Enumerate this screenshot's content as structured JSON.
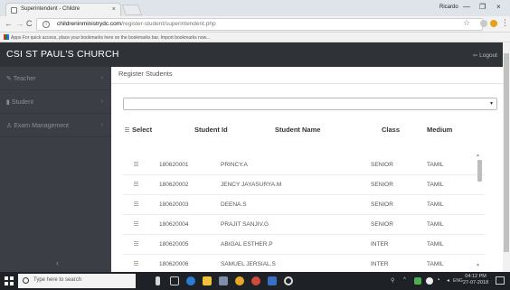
{
  "browser": {
    "tab_title": "Superintendent - Childre",
    "tab_close": "×",
    "profile_name": "Ricardo",
    "controls": {
      "minimize": "—",
      "maximize": "❐",
      "close": "×"
    },
    "nav": {
      "back": "←",
      "forward": "→",
      "reload": "C"
    },
    "url_host": "childreninministrydc.com",
    "url_path": "/register-student/superintendent.php",
    "bookmarks_text": "Apps   For quick access, place your bookmarks here on the bookmarks bar. Import bookmarks now...",
    "star": "☆",
    "menu": "⋮"
  },
  "header": {
    "brand": "CSI ST PAUL'S CHURCH",
    "logout": "⇦ Logout"
  },
  "sidebar": {
    "items": [
      {
        "icon": "✎",
        "label": "Teacher",
        "chev": "›"
      },
      {
        "icon": "▮",
        "label": "Student",
        "chev": "›"
      },
      {
        "icon": "♙",
        "label": "Exam Management",
        "chev": "›"
      }
    ],
    "collapse": "‹"
  },
  "main": {
    "panel_title": "Register Students",
    "select_caret": "▾",
    "columns": [
      "Select",
      "Student Id",
      "Student Name",
      "Class",
      "Medium"
    ],
    "rows": [
      {
        "id": "180620001",
        "name": "PRINCY.A",
        "class": "SENIOR",
        "medium": "TAMIL"
      },
      {
        "id": "180620002",
        "name": "JENCY JAYASURYA.M",
        "class": "SENIOR",
        "medium": "TAMIL"
      },
      {
        "id": "180620003",
        "name": "DEENA.S",
        "class": "SENIOR",
        "medium": "TAMIL"
      },
      {
        "id": "180620004",
        "name": "PRAJIT SANJIV.G",
        "class": "SENIOR",
        "medium": "TAMIL"
      },
      {
        "id": "180620005",
        "name": "ABIGAL ESTHER.P",
        "class": "INTER",
        "medium": "TAMIL"
      },
      {
        "id": "180620006",
        "name": "SAMUEL JERSIAL.S",
        "class": "INTER",
        "medium": "TAMIL"
      }
    ]
  },
  "taskbar": {
    "search_placeholder": "Type here to search",
    "tray_text": "ENG",
    "time": "04:12 PM",
    "date": "27-07-2018"
  },
  "colors": {
    "header_bg": "#2f3237",
    "sidebar_bg": "#3b3e44",
    "taskbar_bg": "#1e2126"
  }
}
